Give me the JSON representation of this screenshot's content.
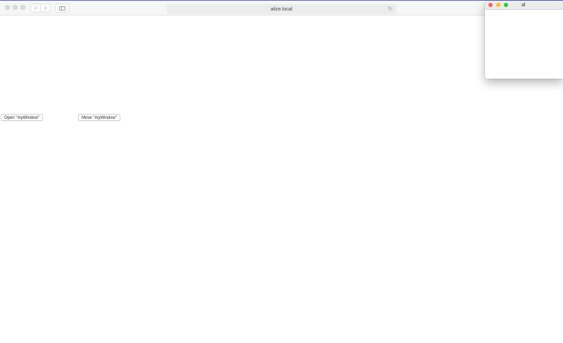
{
  "colors": {
    "accent": "#5b5fd6",
    "close": "#ff5f57",
    "minimize": "#febc2e",
    "zoom": "#28c840"
  },
  "browser": {
    "address": "alice.local",
    "back_icon": "chevron-left-icon",
    "forward_icon": "chevron-right-icon",
    "sidebar_icon": "sidebar-icon",
    "reload_icon": "reload-icon"
  },
  "page": {
    "open_button_label": "Open \"myWindow\"",
    "move_button_label": "Move \"myWindow\""
  },
  "popup": {
    "title": "al"
  }
}
